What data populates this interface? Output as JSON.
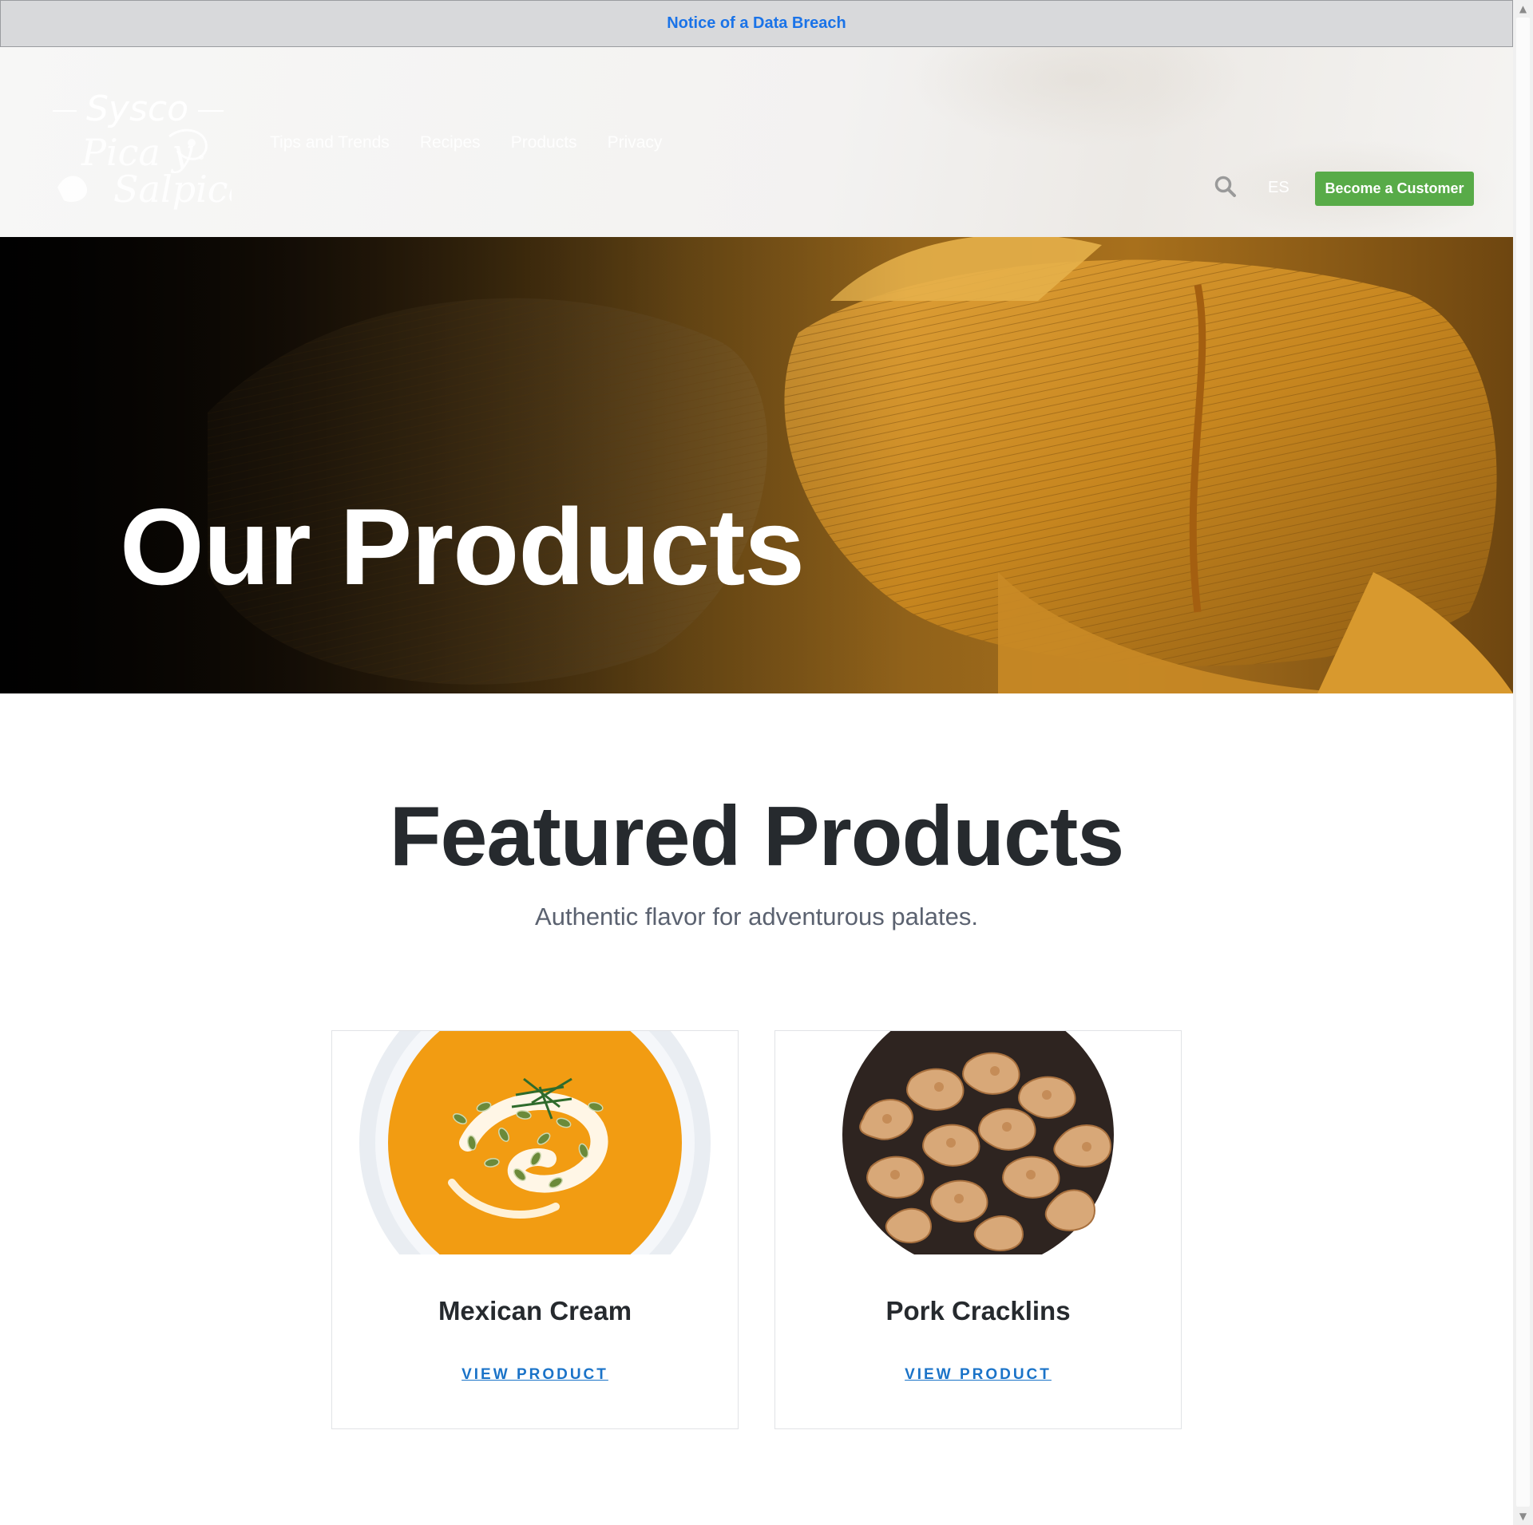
{
  "notice": {
    "label": "Notice of a Data Breach"
  },
  "header": {
    "logo_alt": "Sysco Pica y Salpica",
    "nav": [
      "Tips and Trends",
      "Recipes",
      "Products",
      "Privacy"
    ],
    "search_icon": "search-icon",
    "language_label": "ES",
    "cta_label": "Become a Customer",
    "cta_color": "#58ab48"
  },
  "hero": {
    "title": "Our Products"
  },
  "featured": {
    "title": "Featured Products",
    "subtitle": "Authentic flavor for adventurous palates.",
    "products": [
      {
        "name": "Mexican Cream",
        "link_label": "VIEW PRODUCT"
      },
      {
        "name": "Pork Cracklins",
        "link_label": "VIEW PRODUCT"
      }
    ]
  },
  "colors": {
    "link_blue": "#1a73e8",
    "heading": "#262a2e",
    "subtitle": "#5b6270"
  }
}
